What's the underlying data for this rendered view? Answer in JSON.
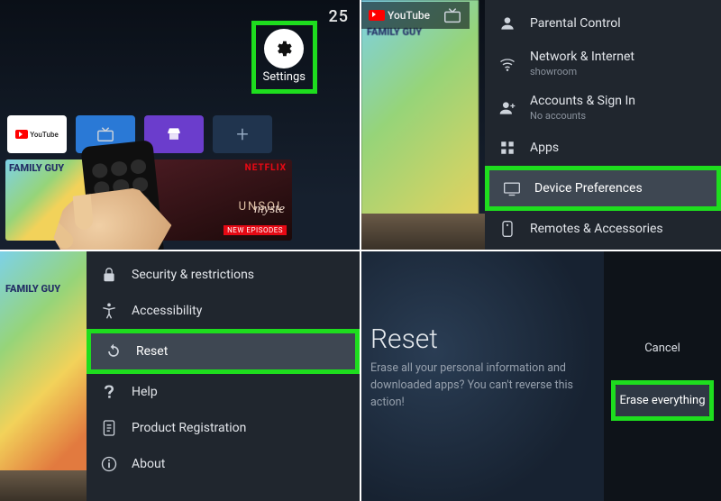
{
  "panel1": {
    "clock": "25",
    "settings_label": "Settings",
    "youtube_label": "YouTube",
    "fg_title": "FAMILY GUY",
    "netflix_brand": "NETFLIX",
    "netflix_line1": "UNSOL",
    "netflix_line2": "myste",
    "netflix_badge": "NEW EPISODES"
  },
  "panel2": {
    "youtube_label": "YouTube",
    "items": [
      {
        "label": "Parental Control",
        "sub": ""
      },
      {
        "label": "Network & Internet",
        "sub": "showroom"
      },
      {
        "label": "Accounts & Sign In",
        "sub": "No accounts"
      },
      {
        "label": "Apps",
        "sub": ""
      },
      {
        "label": "Device Preferences",
        "sub": ""
      },
      {
        "label": "Remotes & Accessories",
        "sub": ""
      }
    ]
  },
  "panel3": {
    "items": [
      {
        "label": "Security & restrictions"
      },
      {
        "label": "Accessibility"
      },
      {
        "label": "Reset"
      },
      {
        "label": "Help"
      },
      {
        "label": "Product Registration"
      },
      {
        "label": "About"
      }
    ]
  },
  "panel4": {
    "title": "Reset",
    "body": "Erase all your personal information and downloaded apps? You can't reverse this action!",
    "cancel": "Cancel",
    "erase": "Erase everything"
  }
}
